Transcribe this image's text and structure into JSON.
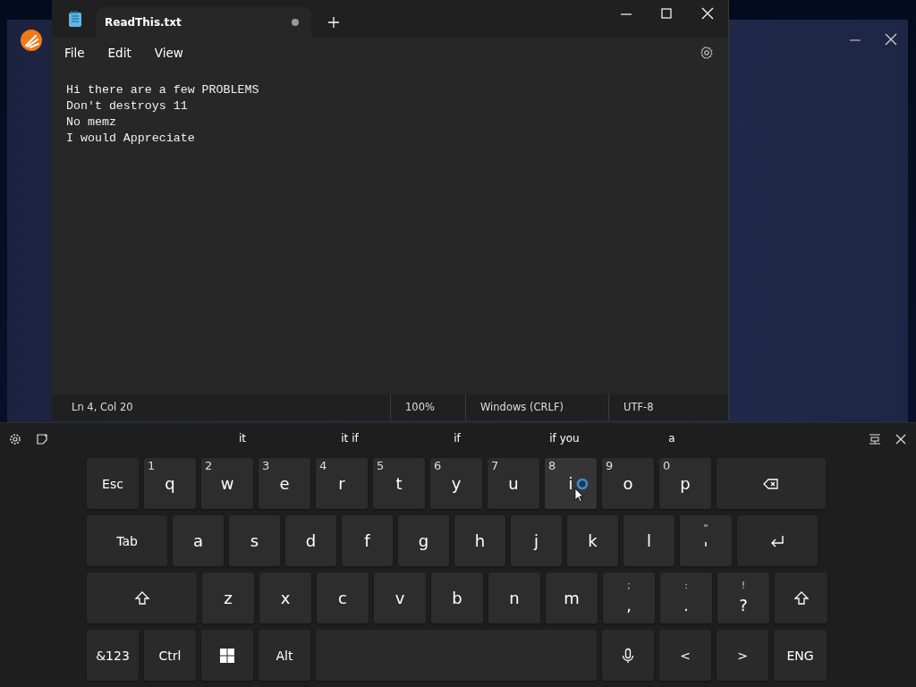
{
  "notepad": {
    "tabs": [
      {
        "label": "ReadThis.txt",
        "selected": true,
        "unsaved": true
      }
    ],
    "menu": [
      "File",
      "Edit",
      "View"
    ],
    "lines": [
      "Hi there are a few PROBLEMS",
      "Don't destroys 11",
      "No memz",
      "I would Appreciate"
    ],
    "status_bar": [
      "Ln 4, Col 20",
      "100%",
      "Windows (CRLF)",
      "UTF-8"
    ]
  },
  "keyboard": {
    "suggestions": [
      "it",
      "it if",
      "if",
      "if you",
      "a"
    ],
    "rows": [
      {
        "keys": [
          {
            "kind": "text",
            "label": "Esc"
          },
          {
            "kind": "letter",
            "label": "q",
            "hint": "1"
          },
          {
            "kind": "letter",
            "label": "w",
            "hint": "2"
          },
          {
            "kind": "letter",
            "label": "e",
            "hint": "3"
          },
          {
            "kind": "letter",
            "label": "r",
            "hint": "4"
          },
          {
            "kind": "letter",
            "label": "t",
            "hint": "5"
          },
          {
            "kind": "letter",
            "label": "y",
            "hint": "6"
          },
          {
            "kind": "letter",
            "label": "u",
            "hint": "7"
          },
          {
            "kind": "letter",
            "label": "i",
            "hint": "8",
            "pressed": true
          },
          {
            "kind": "letter",
            "label": "o",
            "hint": "9"
          },
          {
            "kind": "letter",
            "label": "p",
            "hint": "0"
          },
          {
            "kind": "backspace"
          }
        ]
      },
      {
        "keys": [
          {
            "kind": "text",
            "label": "Tab"
          },
          {
            "kind": "letter",
            "label": "a"
          },
          {
            "kind": "letter",
            "label": "s"
          },
          {
            "kind": "letter",
            "label": "d"
          },
          {
            "kind": "letter",
            "label": "f"
          },
          {
            "kind": "letter",
            "label": "g"
          },
          {
            "kind": "letter",
            "label": "h"
          },
          {
            "kind": "letter",
            "label": "j"
          },
          {
            "kind": "letter",
            "label": "k"
          },
          {
            "kind": "letter",
            "label": "l"
          },
          {
            "kind": "dual",
            "top": "\"",
            "label": "'"
          },
          {
            "kind": "enter"
          }
        ]
      },
      {
        "keys": [
          {
            "kind": "shift"
          },
          {
            "kind": "letter",
            "label": "z"
          },
          {
            "kind": "letter",
            "label": "x"
          },
          {
            "kind": "letter",
            "label": "c"
          },
          {
            "kind": "letter",
            "label": "v"
          },
          {
            "kind": "letter",
            "label": "b"
          },
          {
            "kind": "letter",
            "label": "n"
          },
          {
            "kind": "letter",
            "label": "m"
          },
          {
            "kind": "dual",
            "top": ";",
            "label": ","
          },
          {
            "kind": "dual",
            "top": ":",
            "label": "."
          },
          {
            "kind": "dual",
            "top": "!",
            "label": "?"
          },
          {
            "kind": "shift"
          }
        ]
      },
      {
        "keys": [
          {
            "kind": "text",
            "label": "&123"
          },
          {
            "kind": "text",
            "label": "Ctrl"
          },
          {
            "kind": "windows"
          },
          {
            "kind": "text",
            "label": "Alt"
          },
          {
            "kind": "space"
          },
          {
            "kind": "mic"
          },
          {
            "kind": "text",
            "label": "<"
          },
          {
            "kind": "text",
            "label": ">"
          },
          {
            "kind": "text",
            "label": "ENG"
          }
        ]
      }
    ]
  }
}
